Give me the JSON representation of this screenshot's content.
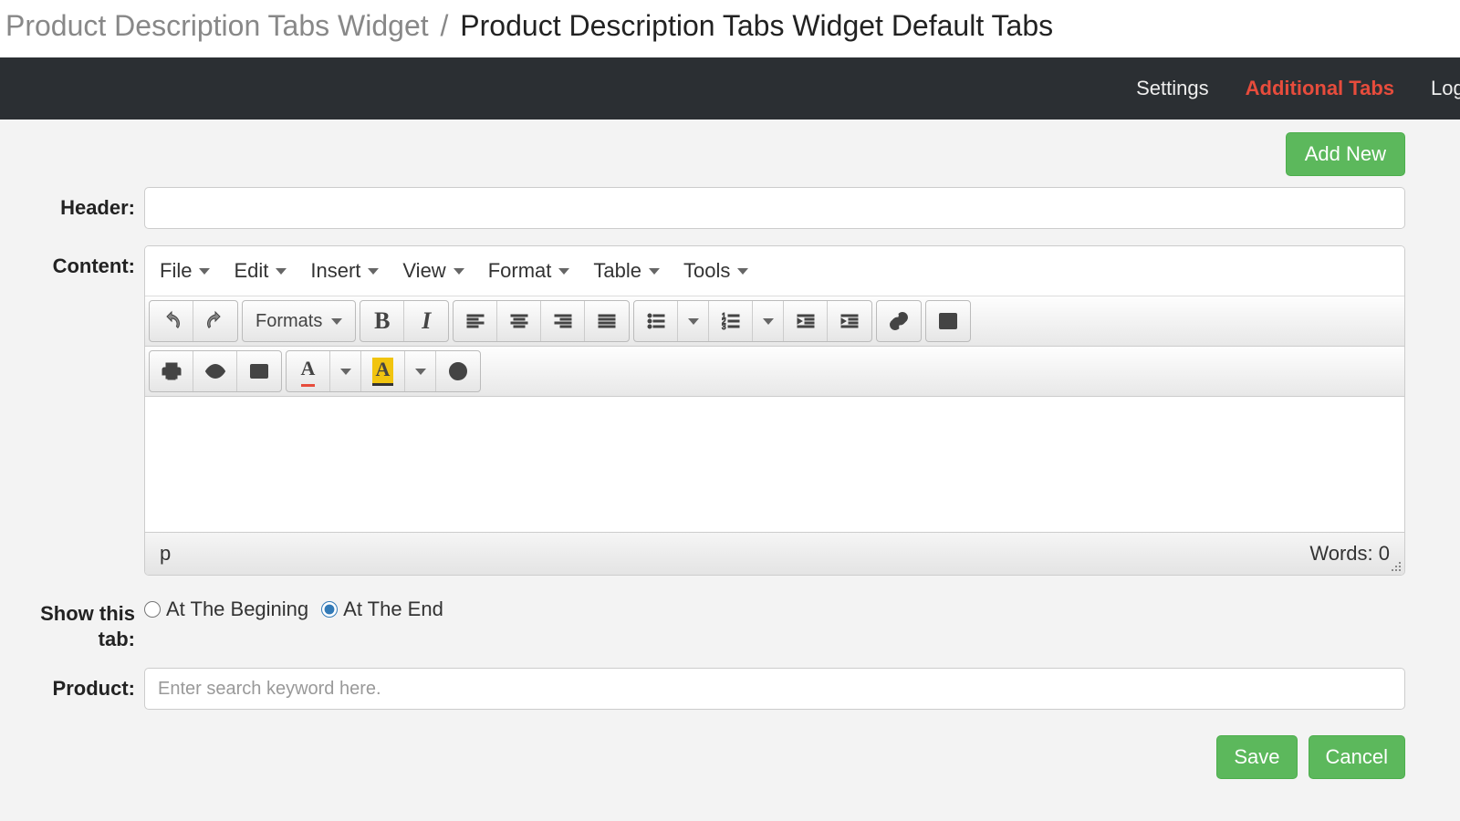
{
  "breadcrumb": {
    "parent": "Product Description Tabs Widget",
    "separator": "/",
    "current": "Product Description Tabs Widget Default Tabs"
  },
  "nav": {
    "settings": "Settings",
    "additional_tabs": "Additional Tabs",
    "log": "Log"
  },
  "buttons": {
    "add_new": "Add New",
    "save": "Save",
    "cancel": "Cancel"
  },
  "labels": {
    "header": "Header:",
    "content": "Content:",
    "show_tab": "Show this tab:",
    "product": "Product:"
  },
  "editor": {
    "menubar": {
      "file": "File",
      "edit": "Edit",
      "insert": "Insert",
      "view": "View",
      "format": "Format",
      "table": "Table",
      "tools": "Tools"
    },
    "toolbar": {
      "formats": "Formats"
    },
    "status": {
      "path": "p",
      "words_label": "Words:",
      "words_count": "0"
    }
  },
  "show_tab_options": {
    "begin": "At The Begining",
    "end": "At The End",
    "selected": "end"
  },
  "product": {
    "placeholder": "Enter search keyword here."
  },
  "header_value": ""
}
